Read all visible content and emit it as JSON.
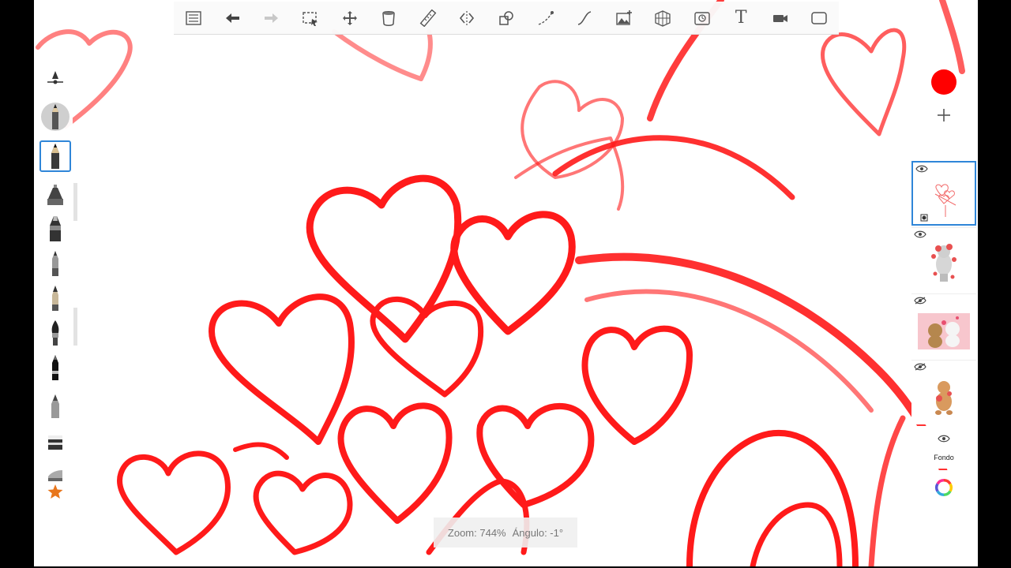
{
  "app": {
    "accent": "#2f86d8"
  },
  "toolbar": {
    "items": [
      {
        "name": "layers-menu-icon"
      },
      {
        "name": "undo-icon"
      },
      {
        "name": "redo-icon"
      },
      {
        "name": "selection-icon"
      },
      {
        "name": "transform-icon"
      },
      {
        "name": "fill-icon"
      },
      {
        "name": "ruler-icon"
      },
      {
        "name": "symmetry-icon"
      },
      {
        "name": "shape-icon"
      },
      {
        "name": "stroke-icon"
      },
      {
        "name": "curve-icon"
      },
      {
        "name": "add-image-icon"
      },
      {
        "name": "perspective-icon"
      },
      {
        "name": "time-lapse-icon"
      },
      {
        "name": "text-icon",
        "label": "T"
      },
      {
        "name": "record-icon"
      },
      {
        "name": "fullscreen-icon"
      }
    ]
  },
  "brushes": {
    "items": [
      {
        "name": "brush-size-icon"
      },
      {
        "name": "pencil-brush"
      },
      {
        "name": "pencil-selected-brush"
      },
      {
        "name": "airbrush-brush"
      },
      {
        "name": "marker-brush"
      },
      {
        "name": "ballpoint-brush"
      },
      {
        "name": "ink-pen-brush"
      },
      {
        "name": "paint-brush"
      },
      {
        "name": "felt-pen-brush"
      },
      {
        "name": "chisel-brush"
      },
      {
        "name": "eraser-brush"
      },
      {
        "name": "smudge-brush"
      },
      {
        "name": "favorites-star-icon"
      }
    ]
  },
  "color": {
    "current": "#ff0000"
  },
  "layers": {
    "items": [
      {
        "name": "layer-1",
        "selected": true
      },
      {
        "name": "layer-2",
        "selected": false
      },
      {
        "name": "layer-3",
        "selected": false
      },
      {
        "name": "layer-4",
        "selected": false
      }
    ],
    "background_label": "Fondo"
  },
  "status": {
    "zoom": "Zoom: 744%",
    "angle": "Ángulo: -1°"
  }
}
